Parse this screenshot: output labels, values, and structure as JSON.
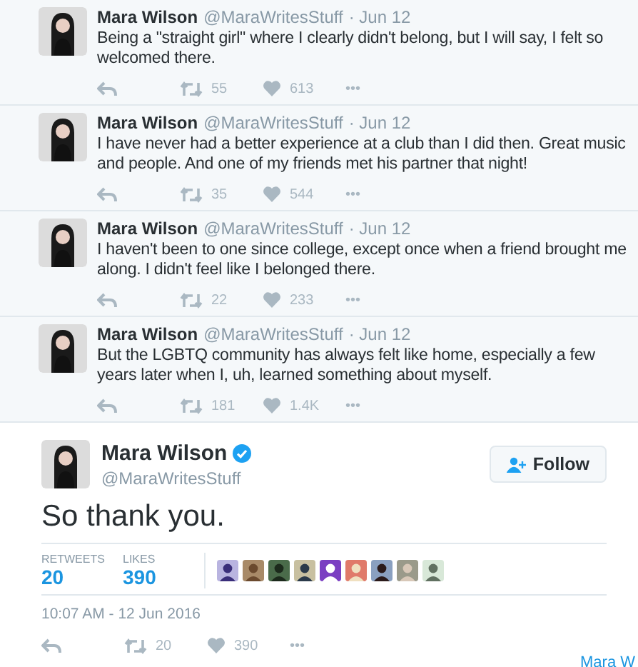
{
  "tweets": [
    {
      "name": "Mara Wilson",
      "handle": "@MaraWritesStuff",
      "date": "· Jun 12",
      "text": "Being a \"straight girl\" where I clearly didn't belong, but I will say, I felt so welcomed there.",
      "retweets": "55",
      "likes": "613",
      "more": "•••"
    },
    {
      "name": "Mara Wilson",
      "handle": "@MaraWritesStuff",
      "date": "· Jun 12",
      "text": "I have never had a better experience at a club than I did then. Great music and people. And one of my friends met his partner that night!",
      "retweets": "35",
      "likes": "544",
      "more": "•••"
    },
    {
      "name": "Mara Wilson",
      "handle": "@MaraWritesStuff",
      "date": "· Jun 12",
      "text": "I haven't been to one since college, except once when a friend brought me along. I didn't feel like I belonged there.",
      "retweets": "22",
      "likes": "233",
      "more": "•••"
    },
    {
      "name": "Mara Wilson",
      "handle": "@MaraWritesStuff",
      "date": "· Jun 12",
      "text": "But the LGBTQ community has always felt like home, especially a few years later when I, uh, learned something about myself.",
      "retweets": "181",
      "likes": "1.4K",
      "more": "•••"
    }
  ],
  "main_tweet": {
    "name": "Mara Wilson",
    "verified": true,
    "handle": "@MaraWritesStuff",
    "follow_button": "Follow",
    "text": "So thank you.",
    "retweets_label": "RETWEETS",
    "retweets": "20",
    "likes_label": "LIKES",
    "likes": "390",
    "timestamp": "10:07 AM - 12 Jun 2016",
    "action_retweets": "20",
    "action_likes": "390",
    "more": "•••"
  },
  "corner_link": "Mara W"
}
